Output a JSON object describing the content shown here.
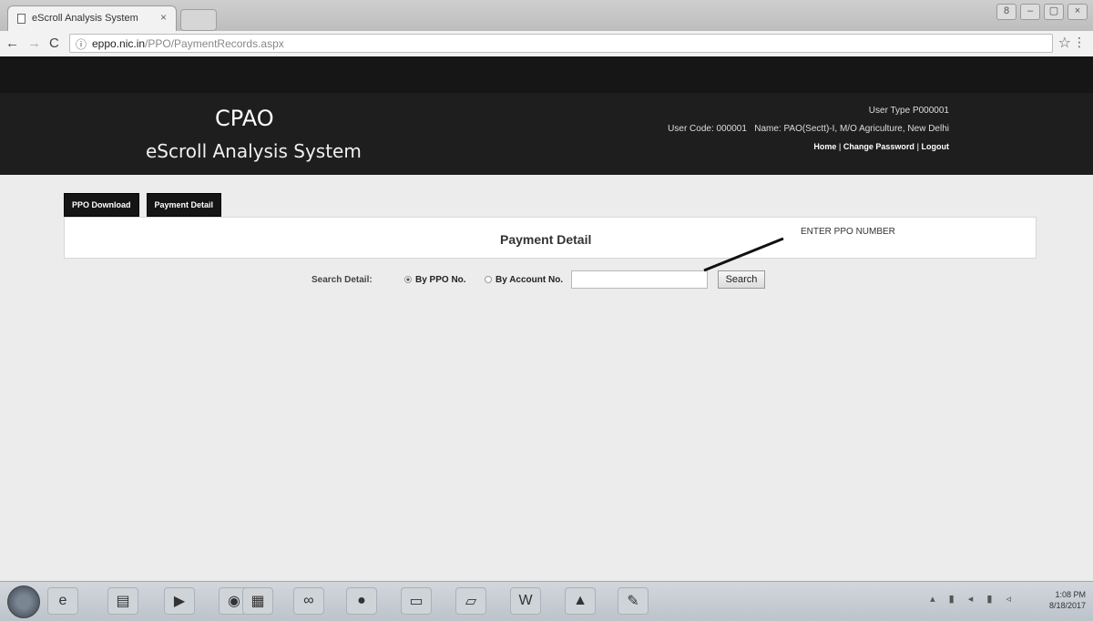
{
  "browser": {
    "tab_title": "eScroll Analysis System",
    "tab_close": "×",
    "url_info": "ⓘ",
    "url_domain": "eppo.nic.in",
    "url_path": "/PPO/PaymentRecords.aspx",
    "back": "←",
    "forward": "→",
    "reload": "C",
    "star": "☆",
    "menu": "⋮",
    "window_controls": [
      "8",
      "–",
      "▢",
      "×"
    ]
  },
  "header": {
    "title": "CPAO",
    "subtitle": "eScroll Analysis System",
    "user_type": "User Type  P000001",
    "user_code": "User Code: 000001",
    "user_name": "Name: PAO(Sectt)-I, M/O Agriculture, New Delhi",
    "links": {
      "home": "Home",
      "change_password": "Change Password",
      "logout": "Logout",
      "separator": "|"
    }
  },
  "menu": {
    "ppo_download": "PPO Download",
    "payment_detail": "Payment Detail"
  },
  "panel": {
    "title": "Payment Detail",
    "annotation": "ENTER PPO NUMBER"
  },
  "search": {
    "label": "Search Detail:",
    "option_ppo": "By PPO No.",
    "option_account": "By Account No.",
    "selected": "By PPO No.",
    "input_value": "",
    "button": "Search"
  },
  "taskbar": {
    "icons": [
      "ie-icon",
      "folder-icon",
      "media-icon",
      "chrome-icon",
      "network-icon",
      "link-icon",
      "app-icon",
      "explorer-icon",
      "notepad-icon",
      "word-icon",
      "pdf-icon",
      "paint-icon"
    ],
    "clock_time": "1:08 PM",
    "clock_date": "8/18/2017"
  }
}
